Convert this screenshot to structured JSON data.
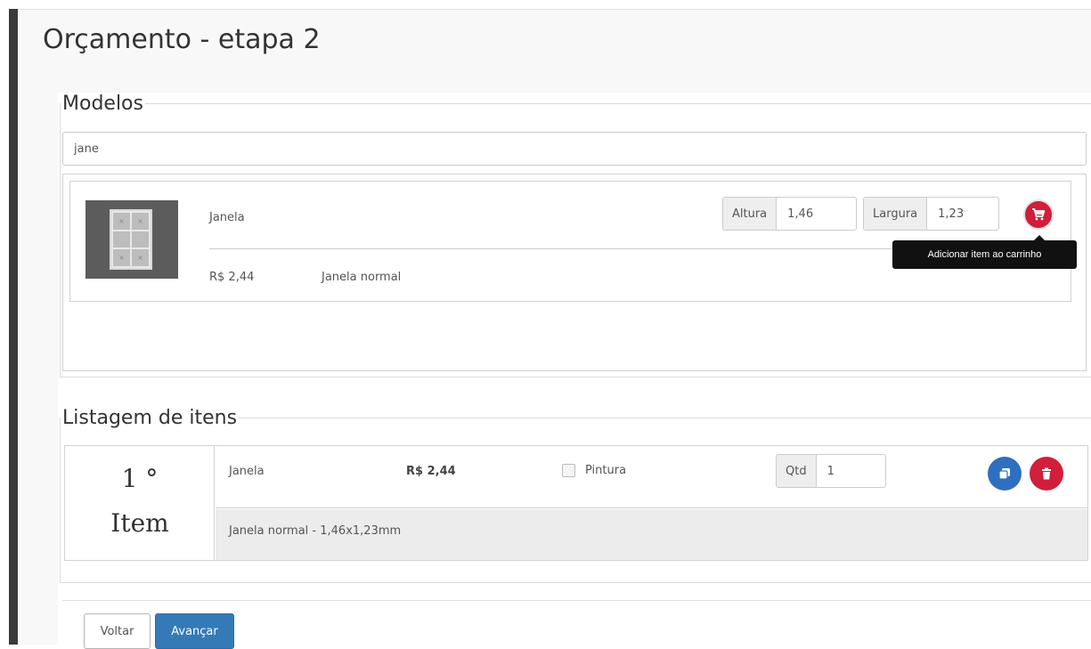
{
  "page": {
    "title": "Orçamento - etapa 2"
  },
  "models": {
    "legend": "Modelos",
    "search_value": "jane",
    "result": {
      "name": "Janela",
      "price": "R$ 2,44",
      "description": "Janela normal",
      "altura_label": "Altura",
      "altura_value": "1,46",
      "largura_label": "Largura",
      "largura_value": "1,23",
      "cart_icon": "cart-icon",
      "cart_tooltip": "Adicionar item ao carrinho",
      "thumbnail_icon": "window-icon"
    }
  },
  "items": {
    "legend": "Listagem de itens",
    "list": [
      {
        "ordinal": "1 °",
        "label": "Item",
        "name": "Janela",
        "price": "R$ 2,44",
        "paint_label": "Pintura",
        "paint_checked": false,
        "qtd_label": "Qtd",
        "qtd_value": "1",
        "description": "Janela normal - 1,46x1,23mm",
        "copy_icon": "copy-icon",
        "delete_icon": "trash-icon"
      }
    ]
  },
  "footer": {
    "back_label": "Voltar",
    "next_label": "Avançar"
  },
  "colors": {
    "primary": "#337ab7",
    "danger": "#d11e3a",
    "copy": "#2f6fbf"
  }
}
